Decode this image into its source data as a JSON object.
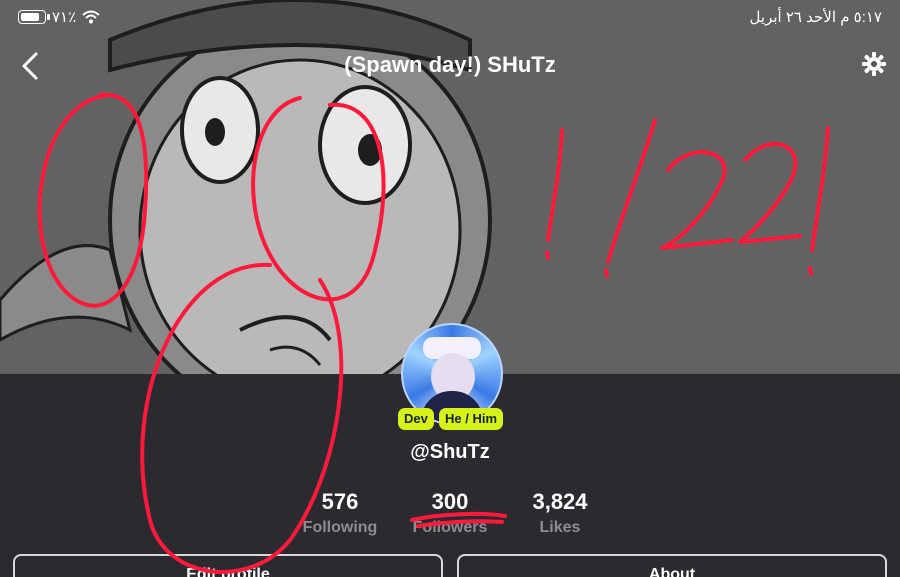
{
  "status_bar": {
    "battery": "٧١٪",
    "time_date": "٥:١٧ م  الأحد ٢٦ أبريل"
  },
  "header": {
    "title": "(Spawn day!) SHuTz"
  },
  "profile": {
    "badges": [
      "Dev",
      "He / Him"
    ],
    "handle": "@ShuTz"
  },
  "stats": [
    {
      "value": "576",
      "label": "Following"
    },
    {
      "value": "300",
      "label": "Followers"
    },
    {
      "value": "3,824",
      "label": "Likes"
    }
  ],
  "buttons": {
    "edit_profile": "Edit profile",
    "about": "About"
  },
  "icons": [
    "battery-icon",
    "wifi-icon",
    "back-chevron-icon",
    "gear-icon"
  ],
  "colors": {
    "background": "#2b2a30",
    "badge": "#d7f21b",
    "scribble": "#ff1a3c"
  }
}
